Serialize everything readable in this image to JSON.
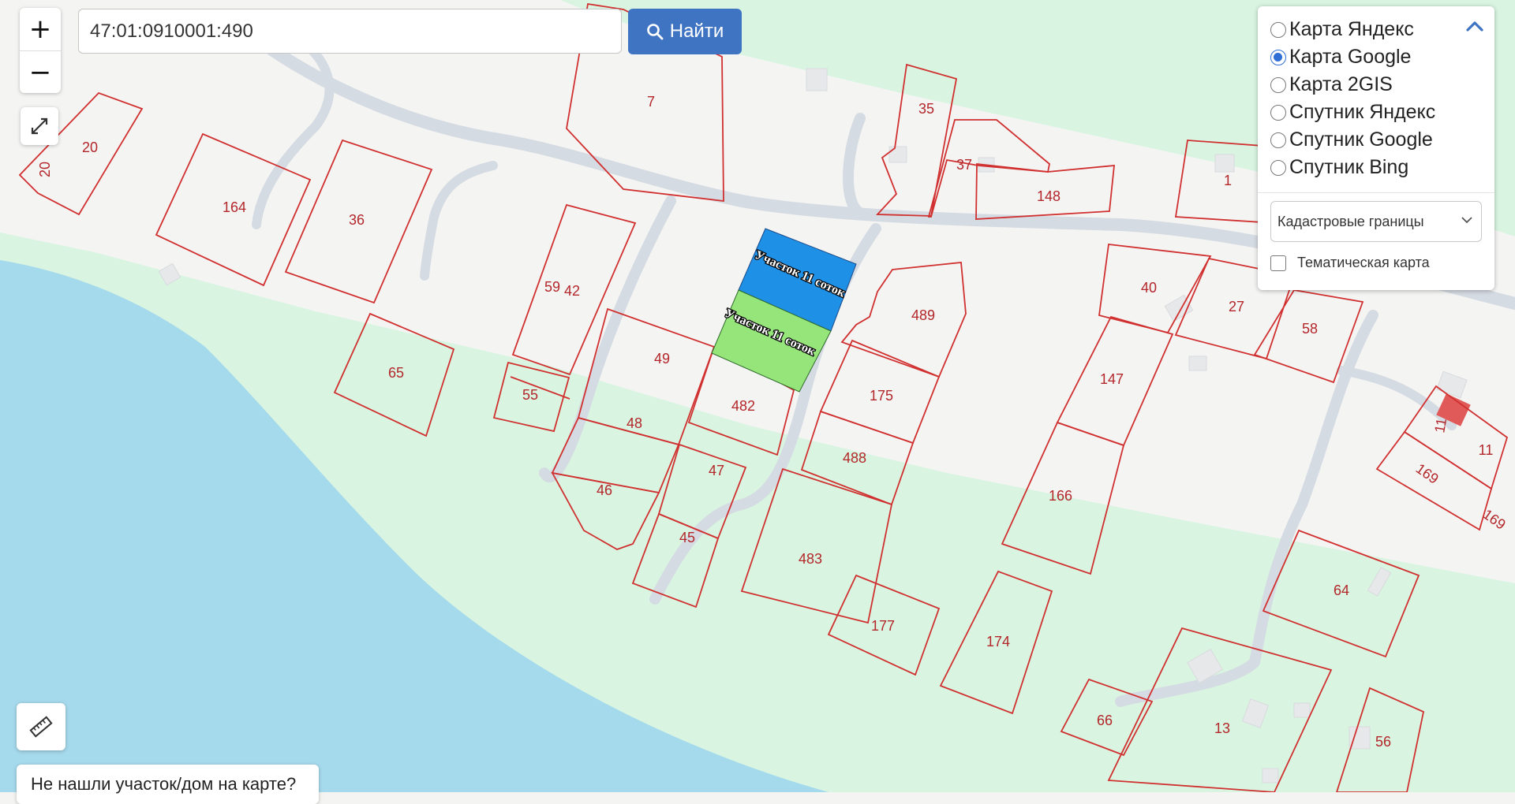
{
  "search": {
    "value": "47:01:0910001:490",
    "button_label": "Найти"
  },
  "zoom": {
    "in_label": "+",
    "out_label": "−"
  },
  "layers": {
    "options": [
      {
        "label": "Карта Яндекс",
        "selected": false
      },
      {
        "label": "Карта Google",
        "selected": true
      },
      {
        "label": "Карта 2GIS",
        "selected": false
      },
      {
        "label": "Спутник Яндекс",
        "selected": false
      },
      {
        "label": "Спутник Google",
        "selected": false
      },
      {
        "label": "Спутник Bing",
        "selected": false
      }
    ],
    "overlay_select": "Кадастровые границы",
    "thematic_label": "Тематическая карта",
    "thematic_checked": false
  },
  "help_button": "Не нашли участок/дом на карте?",
  "highlight": {
    "blue_label": "Участок 11 соток",
    "green_label": "Участок 11 соток",
    "blue_color": "#1e90e6",
    "green_color": "#96e57a"
  },
  "parcels": [
    "7",
    "35",
    "37",
    "148",
    "1",
    "20",
    "20",
    "164",
    "36",
    "59",
    "42",
    "65",
    "49",
    "55",
    "48",
    "46",
    "47",
    "45",
    "482",
    "489",
    "175",
    "488",
    "483",
    "177",
    "174",
    "40",
    "27",
    "58",
    "147",
    "166",
    "64",
    "66",
    "13",
    "56",
    "11",
    "11",
    "169",
    "169"
  ],
  "colors": {
    "water": "#a5d9ec",
    "greenery": "#d9f5e1",
    "land": "#f4f4f3",
    "parcel_border": "#d0302f",
    "accent": "#3f74c3"
  }
}
